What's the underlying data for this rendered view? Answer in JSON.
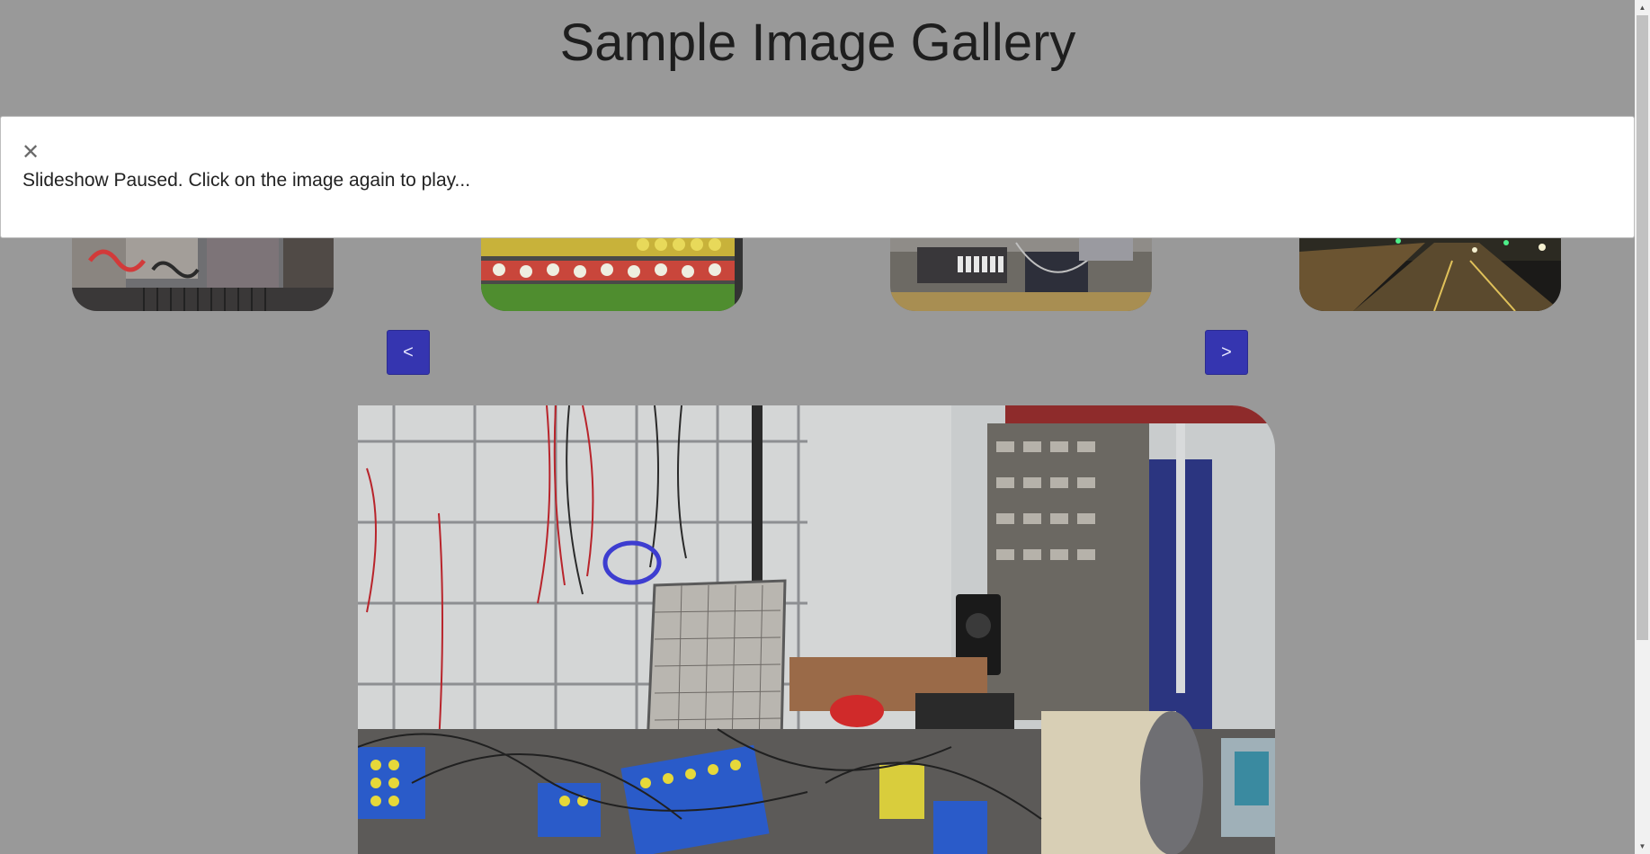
{
  "page": {
    "title": "Sample Image Gallery"
  },
  "notice": {
    "close_glyph": "✕",
    "message": "Slideshow Paused. Click on the image again to play..."
  },
  "nav": {
    "prev_label": "<",
    "next_label": ">"
  },
  "thumbnails": [
    {
      "subject": "graffiti wall"
    },
    {
      "subject": "market shelves"
    },
    {
      "subject": "electronics workbench"
    },
    {
      "subject": "night street"
    }
  ],
  "main_image": {
    "subject": "electronics lab workbench"
  },
  "colors": {
    "background": "#999999",
    "nav_button": "#3535b0",
    "notice_bg": "#ffffff"
  }
}
